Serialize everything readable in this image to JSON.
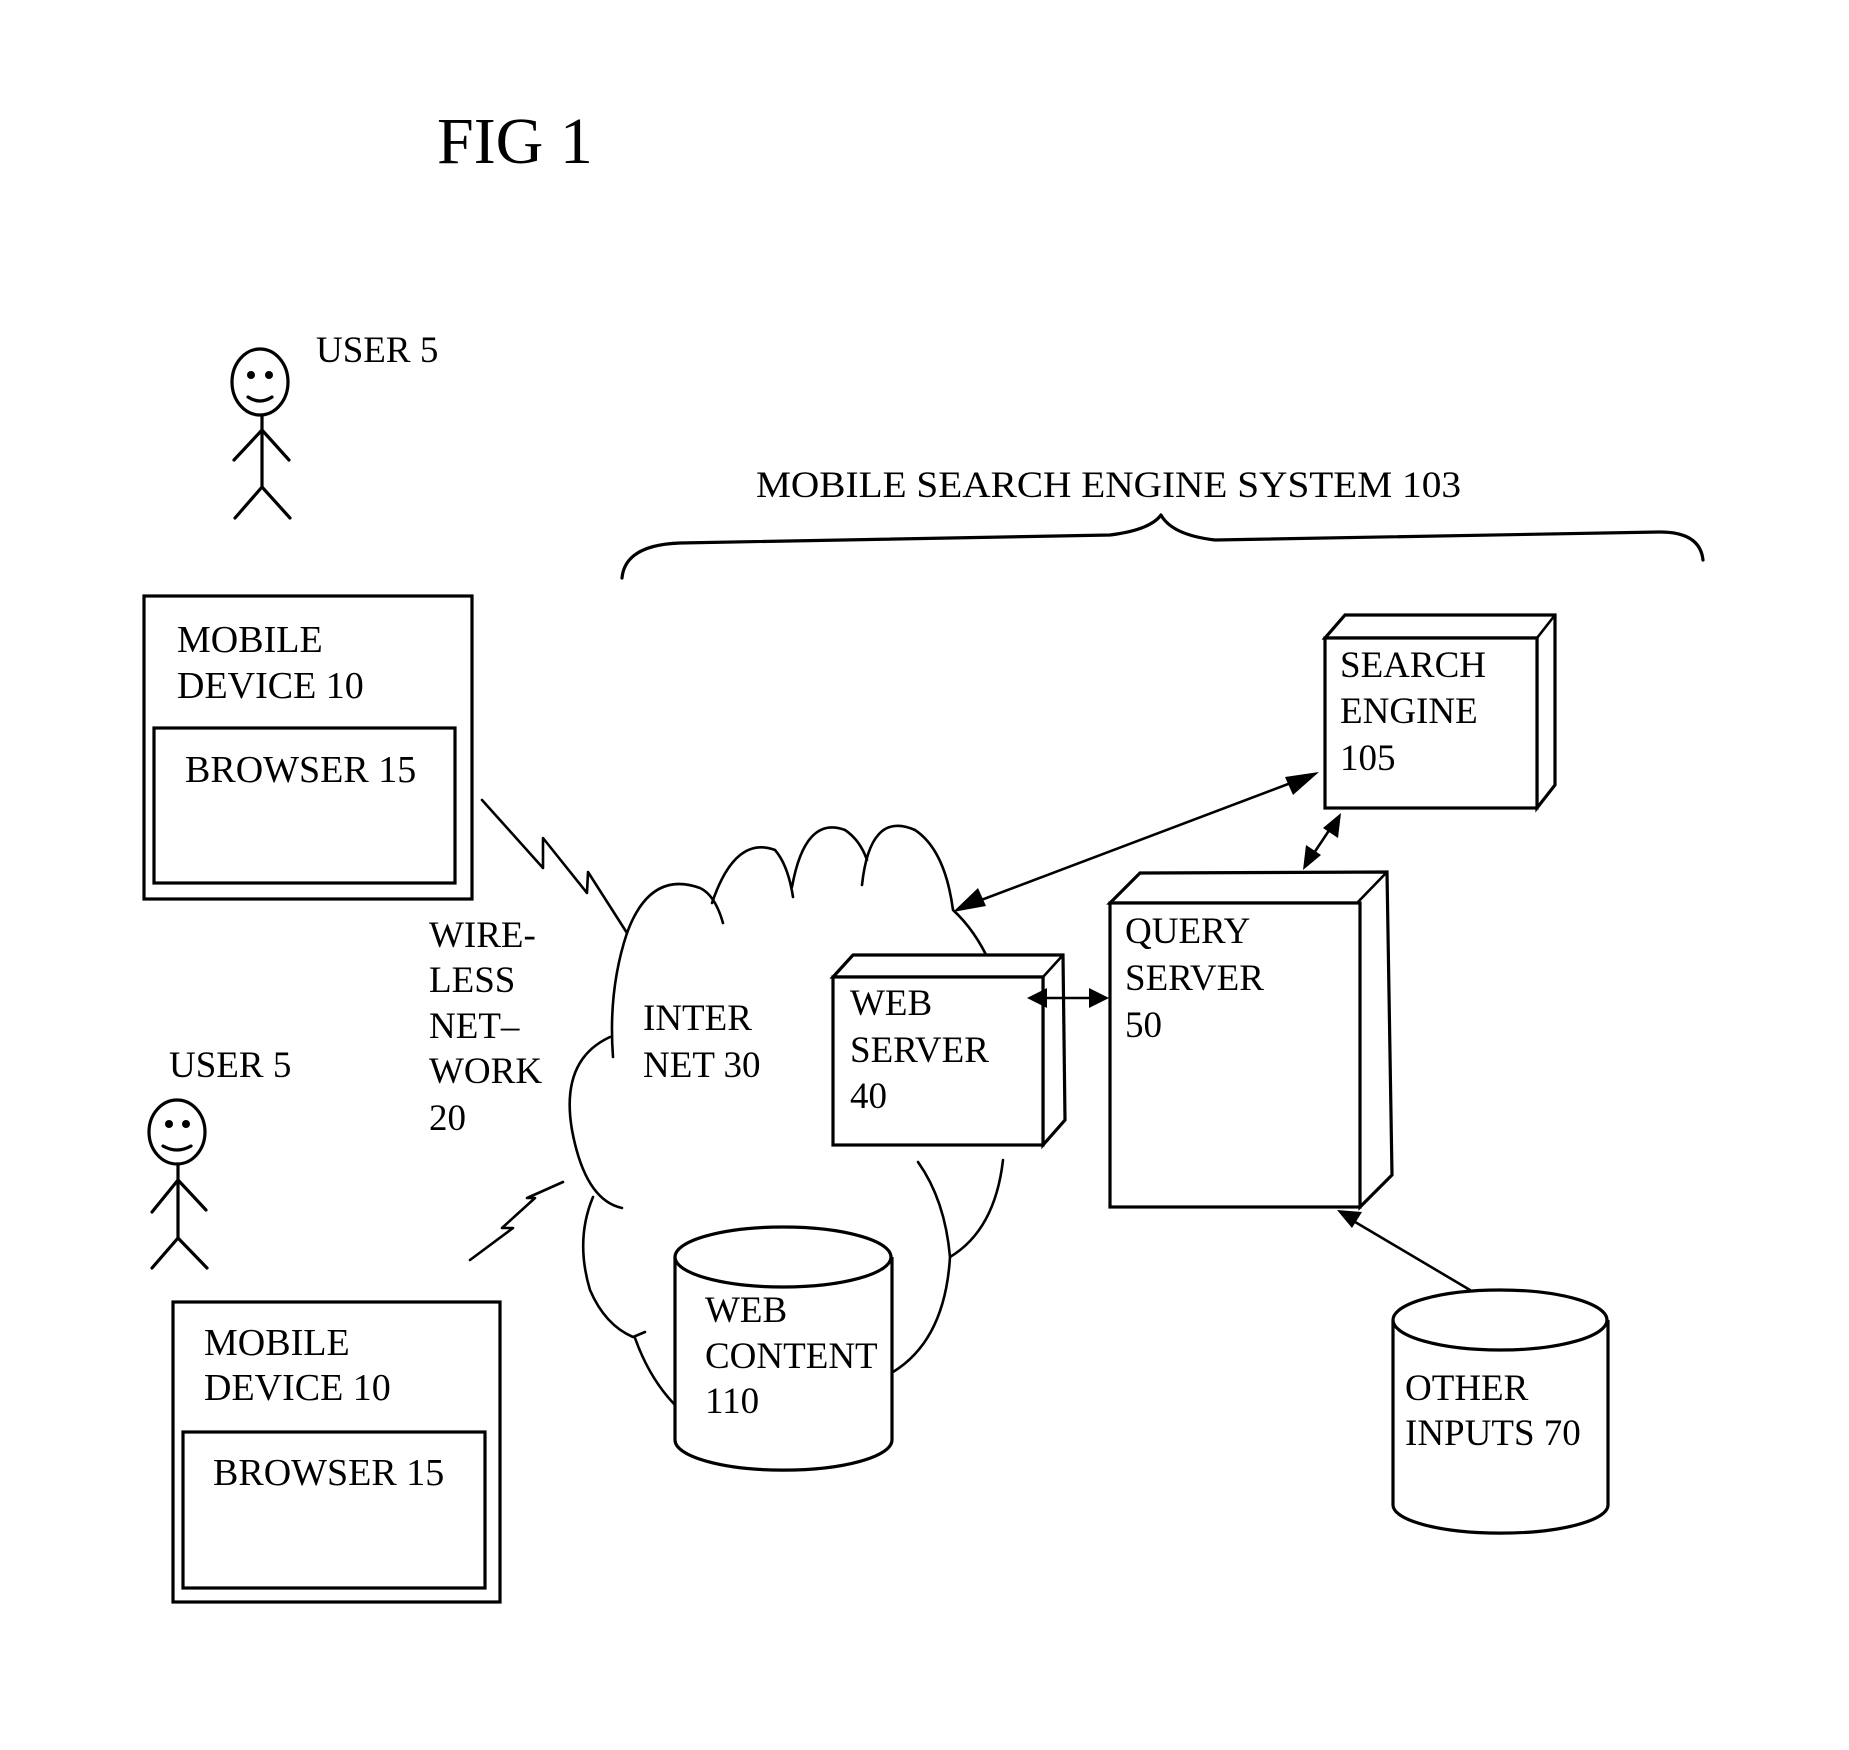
{
  "figure": {
    "title": "FIG 1",
    "system_label": "MOBILE SEARCH ENGINE SYSTEM  103"
  },
  "users": [
    {
      "label": "USER 5",
      "icon": "stick-figure-icon"
    },
    {
      "label": "USER 5",
      "icon": "stick-figure-icon"
    }
  ],
  "mobile_devices": [
    {
      "lines": [
        "MOBILE",
        "DEVICE 10"
      ],
      "browser_label": "BROWSER 15"
    },
    {
      "lines": [
        "MOBILE",
        "DEVICE 10"
      ],
      "browser_label": "BROWSER 15"
    }
  ],
  "wireless_network": {
    "lines": [
      "WIRE-",
      "LESS",
      "NET–",
      "WORK",
      "20"
    ],
    "icon": "lightning-bolt-icon"
  },
  "internet": {
    "lines": [
      "INTER",
      "NET 30"
    ],
    "icon": "cloud-icon"
  },
  "web_server": {
    "lines": [
      "WEB",
      "SERVER",
      "40"
    ]
  },
  "query_server": {
    "lines": [
      "QUERY",
      "SERVER",
      "50"
    ]
  },
  "search_engine": {
    "lines": [
      "SEARCH",
      "ENGINE",
      "105"
    ]
  },
  "web_content": {
    "lines": [
      "WEB",
      "CONTENT",
      "110"
    ],
    "icon": "database-cylinder-icon"
  },
  "other_inputs": {
    "lines": [
      "OTHER",
      "INPUTS 70"
    ],
    "icon": "database-cylinder-icon"
  },
  "connections": [
    {
      "from": "web_server",
      "to": "search_engine",
      "type": "bidirectional"
    },
    {
      "from": "search_engine",
      "to": "query_server",
      "type": "bidirectional"
    },
    {
      "from": "web_server",
      "to": "query_server",
      "type": "bidirectional"
    },
    {
      "from": "other_inputs",
      "to": "query_server",
      "type": "directed"
    },
    {
      "from": "mobile_device_1",
      "to": "internet",
      "type": "wireless"
    },
    {
      "from": "mobile_device_2",
      "to": "internet",
      "type": "wireless"
    }
  ],
  "colors": {
    "ink": "#000000",
    "paper": "#ffffff"
  }
}
